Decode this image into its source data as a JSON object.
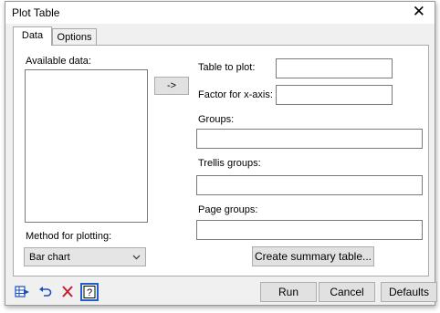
{
  "window": {
    "title": "Plot Table"
  },
  "tabs": [
    {
      "label": "Data"
    },
    {
      "label": "Options"
    }
  ],
  "data_tab": {
    "available_data_label": "Available data:",
    "move_button_label": "->",
    "table_to_plot_label": "Table to plot:",
    "table_to_plot_value": "",
    "factor_x_axis_label": "Factor for x-axis:",
    "factor_x_axis_value": "",
    "groups_label": "Groups:",
    "groups_value": "",
    "trellis_groups_label": "Trellis groups:",
    "trellis_groups_value": "",
    "page_groups_label": "Page groups:",
    "page_groups_value": "",
    "method_label": "Method for plotting:",
    "method_value": "Bar chart",
    "create_summary_label": "Create summary table..."
  },
  "footer": {
    "run_label": "Run",
    "cancel_label": "Cancel",
    "defaults_label": "Defaults",
    "icons": [
      "send-to-spreadsheet-icon",
      "undo-icon",
      "clear-icon",
      "help-icon"
    ]
  },
  "colors": {
    "dialog_bg": "#f0f0f0",
    "help_icon_border": "#1c60c8",
    "undo_icon": "#1c4fbf",
    "clear_icon": "#c0202a"
  }
}
